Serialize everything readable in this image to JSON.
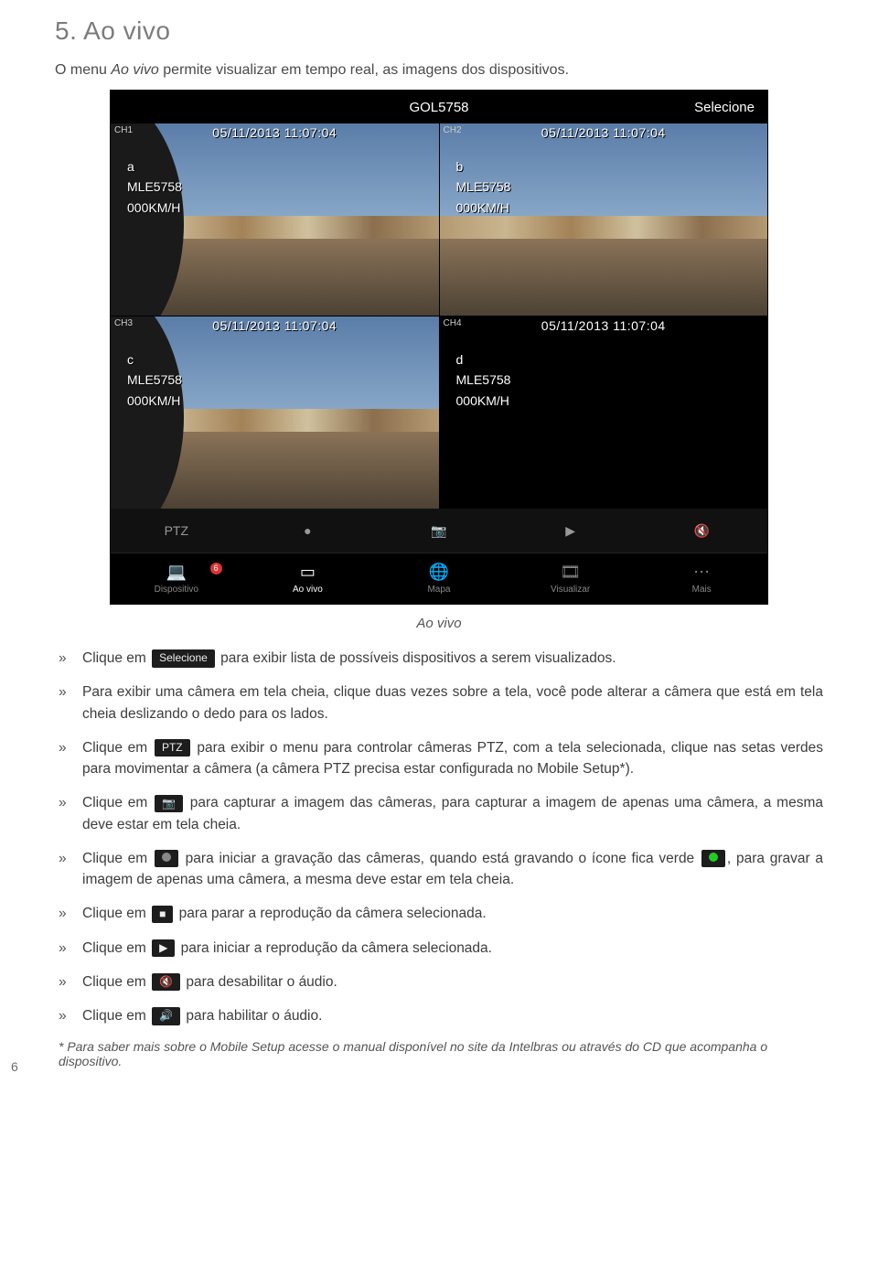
{
  "section": {
    "title": "5. Ao vivo",
    "intro_before": "O menu ",
    "intro_em": "Ao vivo",
    "intro_after": " permite visualizar em tempo real, as imagens dos dispositivos."
  },
  "screenshot": {
    "topbar": {
      "title": "GOL5758",
      "right": "Selecione"
    },
    "cams": [
      {
        "ch": "CH1",
        "ts": "05/11/2013 11:07:04",
        "tag": "a",
        "dev": "MLE5758",
        "spd": "000KM/H",
        "black": false,
        "edge": true
      },
      {
        "ch": "CH2",
        "ts": "05/11/2013 11:07:04",
        "tag": "b",
        "dev": "MLE5758",
        "spd": "000KM/H",
        "black": false,
        "edge": false
      },
      {
        "ch": "CH3",
        "ts": "05/11/2013 11:07:04",
        "tag": "c",
        "dev": "MLE5758",
        "spd": "000KM/H",
        "black": false,
        "edge": true
      },
      {
        "ch": "CH4",
        "ts": "05/11/2013 11:07:04",
        "tag": "d",
        "dev": "MLE5758",
        "spd": "000KM/H",
        "black": true,
        "edge": false
      }
    ],
    "toolbar": {
      "ptz": "PTZ",
      "rec": "●",
      "snap": "📷",
      "play": "▶",
      "mute": "🔇"
    },
    "tabs": {
      "dispositivo": "Dispositivo",
      "aovivo": "Ao vivo",
      "mapa": "Mapa",
      "visualizar": "Visualizar",
      "mais": "Mais",
      "badge": "6"
    }
  },
  "caption": "Ao vivo",
  "buttons": {
    "selecione": "Selecione",
    "ptz": "PTZ"
  },
  "notes": {
    "n1a": "Clique em ",
    "n1b": " para exibir lista de possíveis dispositivos a serem visualizados.",
    "n2": "Para exibir uma câmera em tela cheia, clique duas vezes sobre a tela, você pode alterar a câmera que está em tela cheia deslizando o dedo para os lados.",
    "n3a": "Clique em ",
    "n3b": " para exibir o menu para controlar câmeras PTZ, com a tela selecionada, clique nas setas verdes para movimentar a câmera (a câmera PTZ precisa estar configurada no Mobile Setup*).",
    "n4a": "Clique em ",
    "n4b": " para capturar a imagem das câmeras, para capturar a imagem de apenas uma câmera, a mesma deve estar em tela cheia.",
    "n5a": "Clique em ",
    "n5b": " para iniciar a gravação das câmeras, quando está gravando o ícone fica verde ",
    "n5c": ", para gravar a imagem de apenas uma câmera, a mesma deve estar em tela cheia.",
    "n6a": "Clique em ",
    "n6b": " para parar a reprodução da câmera selecionada.",
    "n7a": "Clique em ",
    "n7b": " para iniciar a reprodução da câmera selecionada.",
    "n8a": "Clique em ",
    "n8b": " para desabilitar o áudio.",
    "n9a": "Clique em ",
    "n9b": " para habilitar o áudio."
  },
  "footnote": "* Para saber mais sobre o Mobile Setup acesse o manual disponível no site da Intelbras ou através do CD que acompanha o dispositivo.",
  "pagenum": "6"
}
